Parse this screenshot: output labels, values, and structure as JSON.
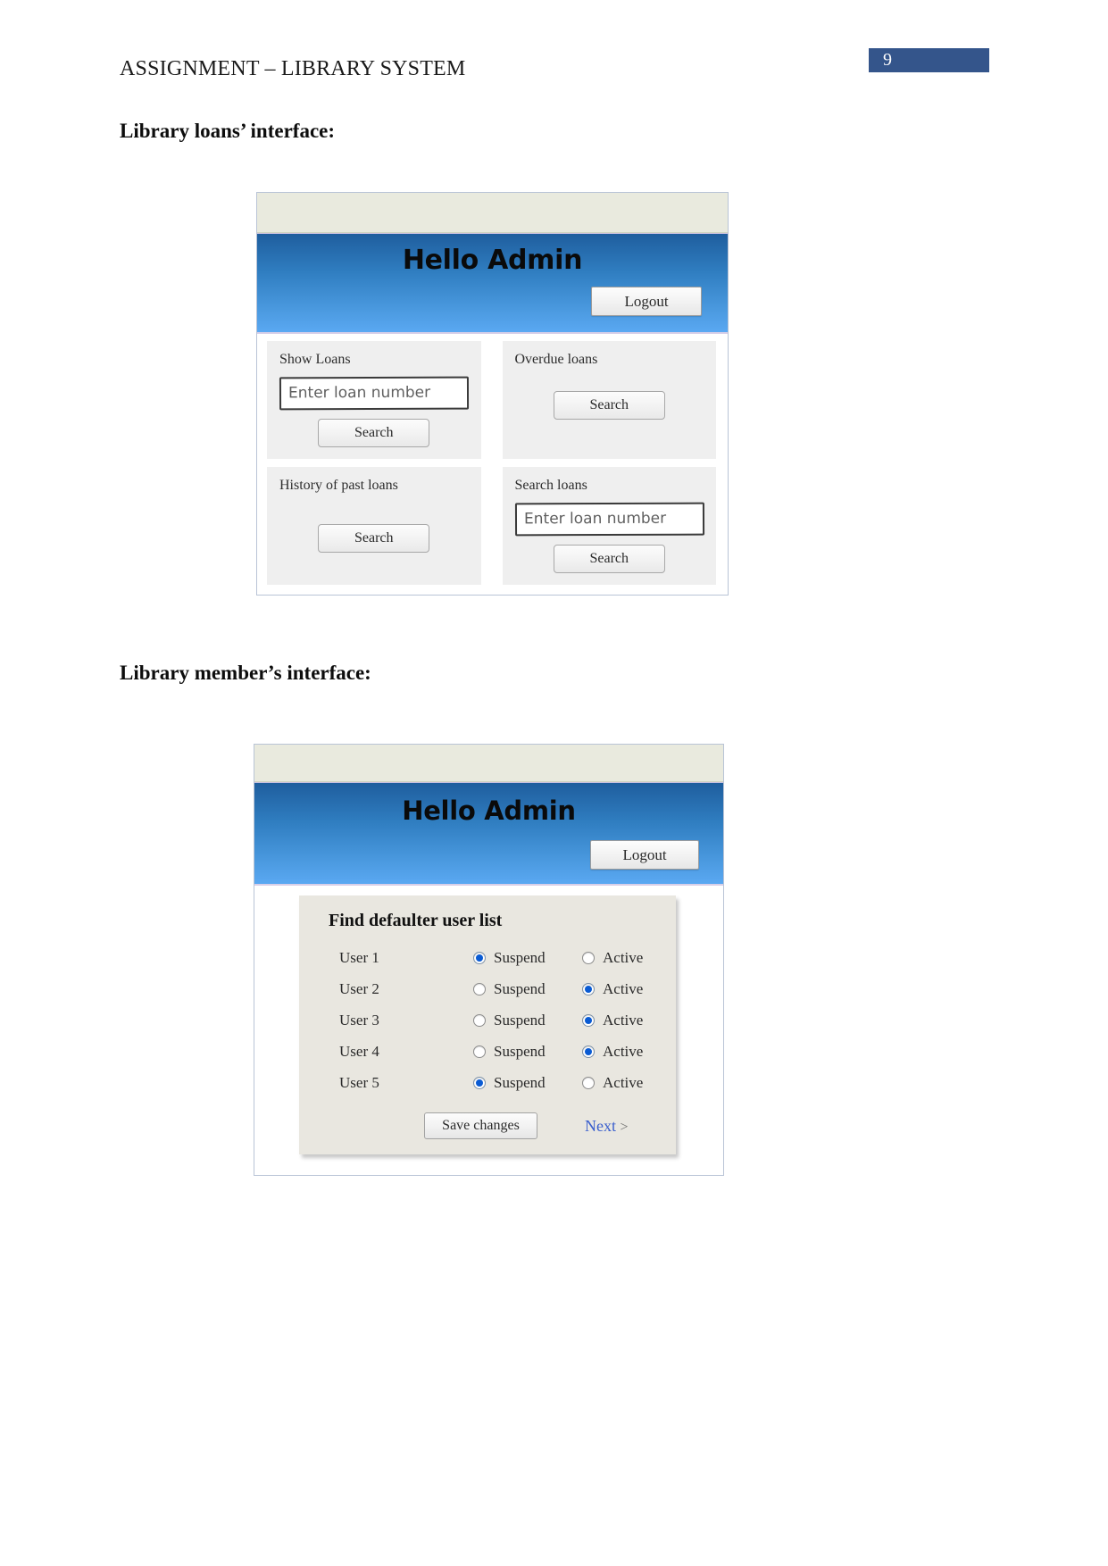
{
  "document": {
    "header_title": "ASSIGNMENT – LIBRARY SYSTEM",
    "page_number": "9",
    "page_number_bg": "#34558b",
    "headings": {
      "loans": "Library loans’ interface:",
      "member": "Library member’s interface:"
    }
  },
  "loans_mockup": {
    "greeting": "Hello Admin",
    "logout_label": "Logout",
    "panels": [
      {
        "label": "Show Loans",
        "input_placeholder": "Enter loan number",
        "button_label": "Search"
      },
      {
        "label": "Overdue loans",
        "button_label": "Search"
      },
      {
        "label": "History of past loans",
        "button_label": "Search"
      },
      {
        "label": "Search loans",
        "input_placeholder": "Enter loan number",
        "button_label": "Search"
      }
    ]
  },
  "member_mockup": {
    "greeting": "Hello Admin",
    "logout_label": "Logout",
    "card": {
      "title": "Find defaulter user list",
      "option_labels": {
        "suspend": "Suspend",
        "active": "Active"
      },
      "rows": [
        {
          "user": "User 1",
          "suspend_selected": true,
          "active_selected": false
        },
        {
          "user": "User 2",
          "suspend_selected": false,
          "active_selected": true
        },
        {
          "user": "User 3",
          "suspend_selected": false,
          "active_selected": true
        },
        {
          "user": "User 4",
          "suspend_selected": false,
          "active_selected": true
        },
        {
          "user": "User 5",
          "suspend_selected": true,
          "active_selected": false
        }
      ],
      "save_label": "Save changes",
      "next_label": "Next",
      "next_chevron": ">"
    }
  }
}
